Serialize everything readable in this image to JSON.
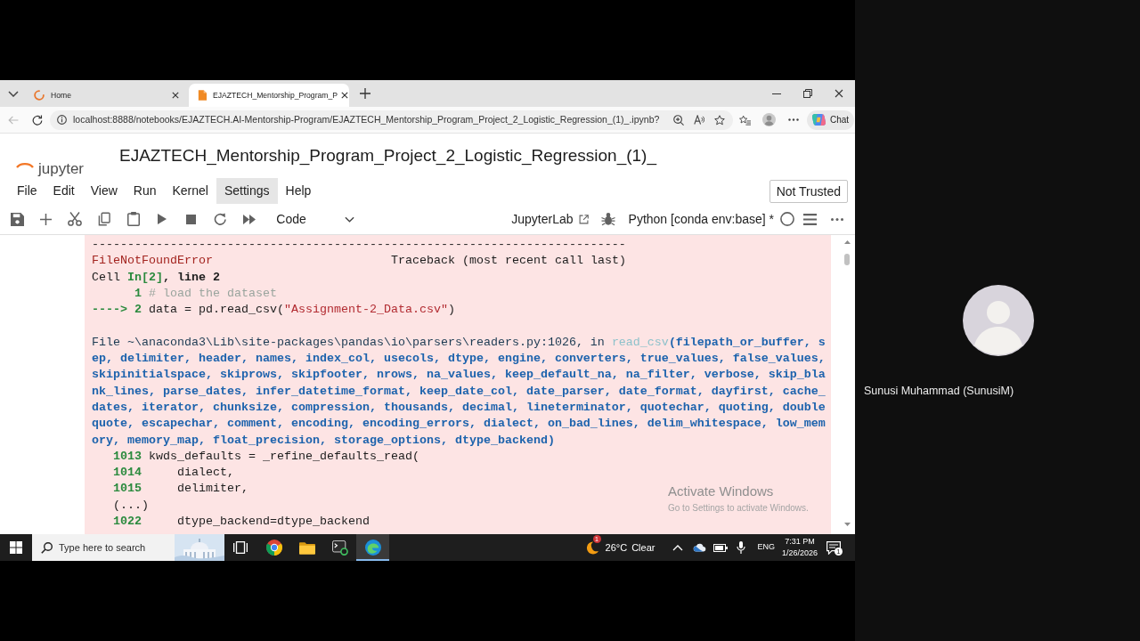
{
  "browser": {
    "tabs": [
      {
        "kind": "loading",
        "label": "Home",
        "selected": false
      },
      {
        "kind": "notebook",
        "label": "EJAZTECH_Mentorship_Program_P",
        "selected": true
      }
    ],
    "back_disabled": true,
    "address": "localhost:8888/notebooks/EJAZTECH.AI-Mentorship-Program/EJAZTECH_Mentorship_Program_Project_2_Logistic_Regression_(1)_.ipynb?",
    "chat": "Chat"
  },
  "notebook": {
    "logo": "jupyter",
    "title": "EJAZTECH_Mentorship_Program_Project_2_Logistic_Regression_(1)_",
    "menu": [
      {
        "label": "File",
        "selected": false
      },
      {
        "label": "Edit",
        "selected": false
      },
      {
        "label": "View",
        "selected": false
      },
      {
        "label": "Run",
        "selected": false
      },
      {
        "label": "Kernel",
        "selected": false
      },
      {
        "label": "Settings",
        "selected": true
      },
      {
        "label": "Help",
        "selected": false
      }
    ],
    "trust": "Not Trusted",
    "cell_type": "Code",
    "launcher": "JupyterLab",
    "kernel": "Python [conda env:base] *",
    "kernel_busy": false,
    "output": [
      {
        "kind": "rule",
        "text": "---------------------------------------------------------------------------"
      },
      {
        "kind": "header",
        "error": "FileNotFoundError",
        "title": "Traceback (most recent call last)"
      },
      {
        "kind": "text",
        "segments": [
          {
            "kind": "plain",
            "text": "Cell "
          },
          {
            "kind": "lineno",
            "text": "In[2]"
          },
          {
            "kind": "bold",
            "text": ", line 2"
          }
        ]
      },
      {
        "kind": "source",
        "number": "1",
        "code": [
          {
            "kind": "comment",
            "text": "# load the dataset"
          }
        ]
      },
      {
        "kind": "source",
        "number": "----> 2",
        "code": [
          {
            "kind": "plain",
            "text": "data = pd.read_csv("
          },
          {
            "kind": "string",
            "text": "\"Assignment-2_Data.csv\""
          },
          {
            "kind": "plain",
            "text": ")"
          }
        ]
      },
      {
        "kind": "frame",
        "segments": [
          {
            "kind": "path",
            "text": "File ~\\anaconda3\\Lib\\site-packages\\pandas\\io\\parsers\\readers.py:1026, in "
          },
          {
            "kind": "func",
            "text": "read_csv"
          },
          {
            "kind": "args",
            "text": "(filepath_or_buffer, sep, delimiter, header, names, index_col, usecols, dtype, engine, converters, true_values, false_values, skipinitialspace, skiprows, skipfooter, nrows, na_values, keep_default_na, na_filter, verbose, skip_blank_lines, parse_dates, infer_datetime_format, keep_date_col, date_parser, date_format, dayfirst, cache_dates, iterator, chunksize, compression, thousands, decimal, lineterminator, quotechar, quoting, doublequote, escapechar, comment, encoding, encoding_errors, dialect, on_bad_lines, delim_whitespace, low_memory, memory_map, float_precision, storage_options, dtype_backend)"
          }
        ]
      },
      {
        "kind": "source",
        "number": "1013",
        "code": [
          {
            "kind": "plain",
            "text": "kwds_defaults = _refine_defaults_read("
          }
        ]
      },
      {
        "kind": "source",
        "number": "1014",
        "code": [
          {
            "kind": "plain",
            "text": "    dialect,"
          }
        ]
      },
      {
        "kind": "source",
        "number": "1015",
        "code": [
          {
            "kind": "plain",
            "text": "    delimiter,"
          }
        ]
      },
      {
        "kind": "skip",
        "text": "(...)"
      },
      {
        "kind": "source",
        "number": "1022",
        "code": [
          {
            "kind": "plain",
            "text": "    dtype_backend=dtype_backend"
          }
        ]
      }
    ]
  },
  "activation_notice": {
    "title": "Activate Windows",
    "hint": "Go to Settings to activate Windows."
  },
  "taskbar": {
    "search": {
      "placeholder": "Type here to search"
    },
    "apps": [
      {
        "kind": "circle",
        "selected": false
      },
      {
        "kind": "folder",
        "selected": false
      },
      {
        "kind": "terminal",
        "selected": false
      },
      {
        "kind": "swirl",
        "selected": true
      }
    ],
    "weather": {
      "badge": "1",
      "temperature": "26°C",
      "condition": "Clear"
    },
    "language": "ENG",
    "time": "7:31 PM",
    "date": "1/26/2026",
    "notification_badge": "1"
  },
  "participant": {
    "name": "Sunusi Muhammad (SunusiM)"
  }
}
